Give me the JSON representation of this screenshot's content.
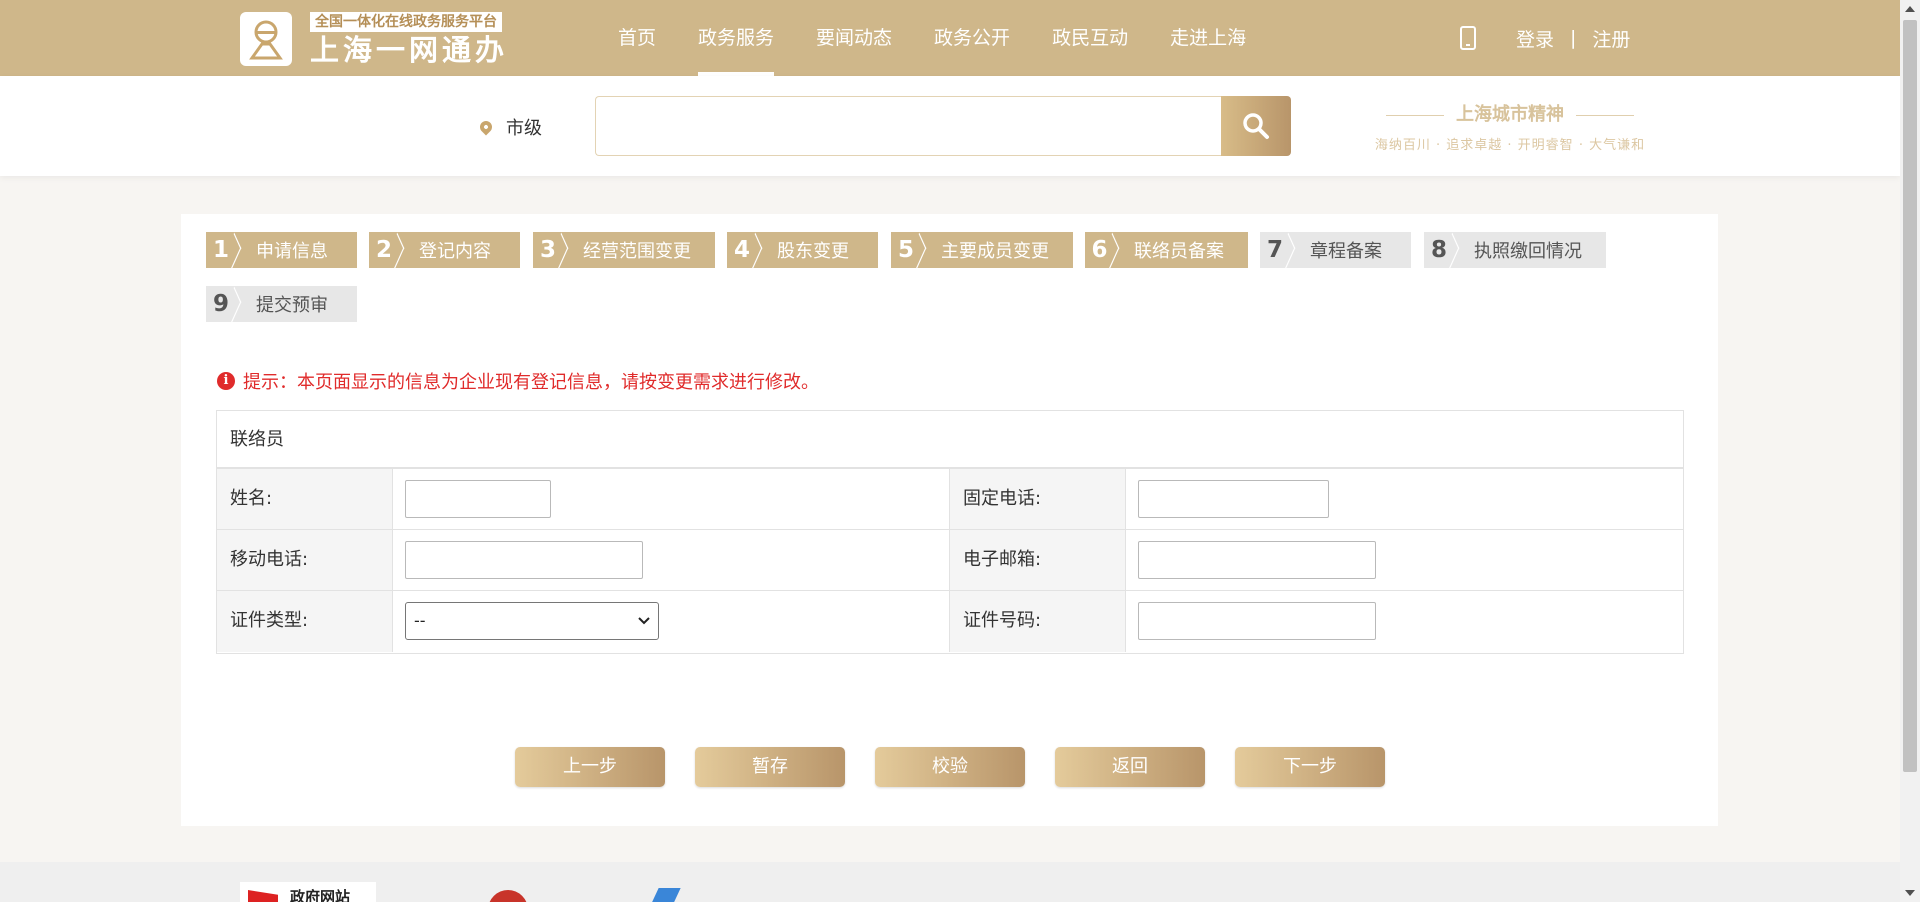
{
  "header": {
    "logo_tag": "全国一体化在线政务服务平台",
    "logo_name": "上海一网通办",
    "nav": [
      {
        "label": "首页",
        "active": false
      },
      {
        "label": "政务服务",
        "active": true
      },
      {
        "label": "要闻动态",
        "active": false
      },
      {
        "label": "政务公开",
        "active": false
      },
      {
        "label": "政民互动",
        "active": false
      },
      {
        "label": "走进上海",
        "active": false
      }
    ],
    "login": "登录",
    "separator": "|",
    "register": "注册"
  },
  "search": {
    "region": "市级",
    "value": "",
    "slogan_title": "上海城市精神",
    "slogan_sub": "海纳百川 · 追求卓越 · 开明睿智 · 大气谦和"
  },
  "steps": [
    {
      "num": "1",
      "label": "申请信息",
      "done": true
    },
    {
      "num": "2",
      "label": "登记内容",
      "done": true
    },
    {
      "num": "3",
      "label": "经营范围变更",
      "done": true
    },
    {
      "num": "4",
      "label": "股东变更",
      "done": true
    },
    {
      "num": "5",
      "label": "主要成员变更",
      "done": true
    },
    {
      "num": "6",
      "label": "联络员备案",
      "done": true
    },
    {
      "num": "7",
      "label": "章程备案",
      "done": false
    },
    {
      "num": "8",
      "label": "执照缴回情况",
      "done": false
    },
    {
      "num": "9",
      "label": "提交预审",
      "done": false
    }
  ],
  "notice": "提示：本页面显示的信息为企业现有登记信息，请按变更需求进行修改。",
  "form": {
    "section_title": "联络员",
    "name_label": "姓名:",
    "name_value": "",
    "landline_label": "固定电话:",
    "landline_value": "",
    "mobile_label": "移动电话:",
    "mobile_value": "",
    "email_label": "电子邮箱:",
    "email_value": "",
    "idtype_label": "证件类型:",
    "idtype_value": "--",
    "idnum_label": "证件号码:",
    "idnum_value": ""
  },
  "buttons": {
    "prev": "上一步",
    "save": "暂存",
    "check": "校验",
    "back": "返回",
    "next": "下一步"
  },
  "footer": {
    "site": "政府网站"
  },
  "colors": {
    "brand_gold": "#cfb78a",
    "step_todo": "#e7e7e7",
    "notice_red": "#e02b2b"
  }
}
